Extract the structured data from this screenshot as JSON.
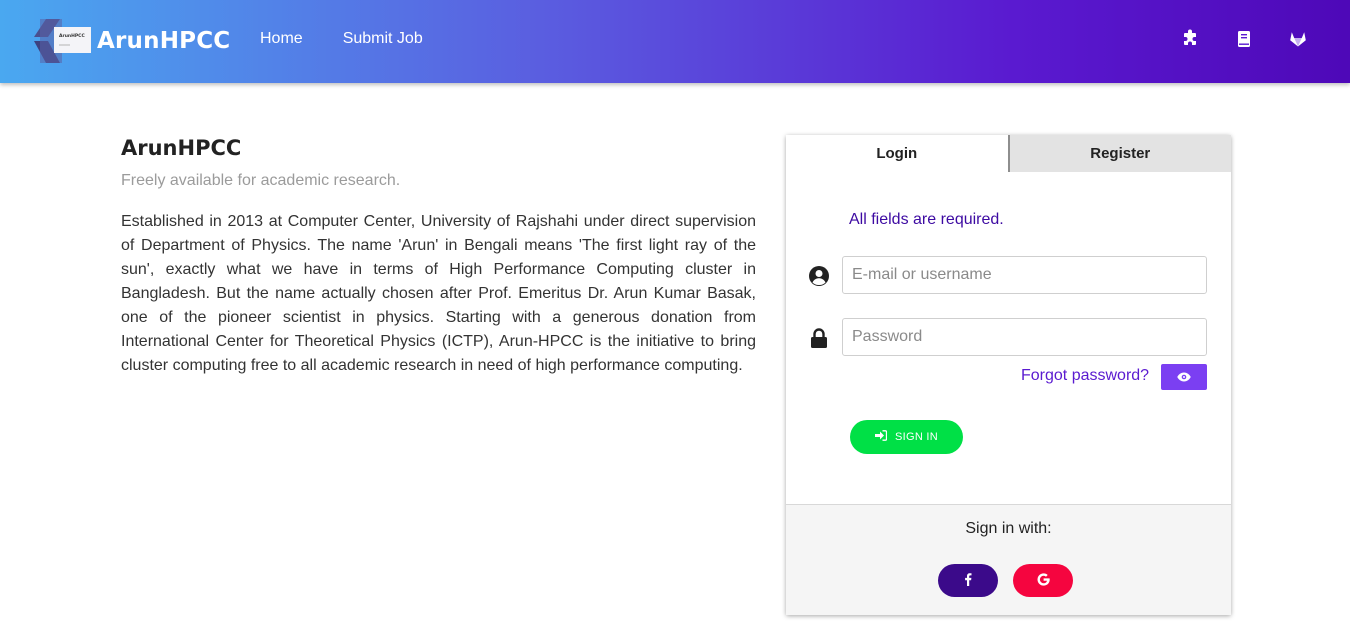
{
  "header": {
    "brand": "ArunHPCC",
    "logo_text": "ArunHPCC",
    "nav": [
      {
        "label": "Home"
      },
      {
        "label": "Submit Job"
      }
    ],
    "icons": [
      "puzzle-icon",
      "book-icon",
      "gitlab-icon"
    ]
  },
  "intro": {
    "title": "ArunHPCC",
    "tagline": "Freely available for academic research.",
    "description": "Established in 2013 at Computer Center, University of Rajshahi under direct supervision of Department of Physics. The name 'Arun' in Bengali means 'The first light ray of the sun', exactly what we have in terms of High Performance Computing cluster in Bangladesh. But the name actually chosen after Prof. Emeritus Dr. Arun Kumar Basak, one of the pioneer scientist in physics. Starting with a generous donation from International Center for Theoretical Physics (ICTP), Arun-HPCC is the initiative to bring cluster computing free to all academic research in need of high performance computing."
  },
  "login": {
    "tabs": [
      {
        "label": "Login",
        "active": true
      },
      {
        "label": "Register",
        "active": false
      }
    ],
    "required_note": "All fields are required.",
    "username": {
      "placeholder": "E-mail or username",
      "value": ""
    },
    "password": {
      "placeholder": "Password",
      "value": ""
    },
    "forgot_label": "Forgot password?",
    "signin_label": "SIGN IN",
    "social_title": "Sign in with:"
  },
  "colors": {
    "accent": "#5a1ad0",
    "signin": "#00e046",
    "facebook": "#3b0a8a",
    "google": "#f5053f"
  }
}
